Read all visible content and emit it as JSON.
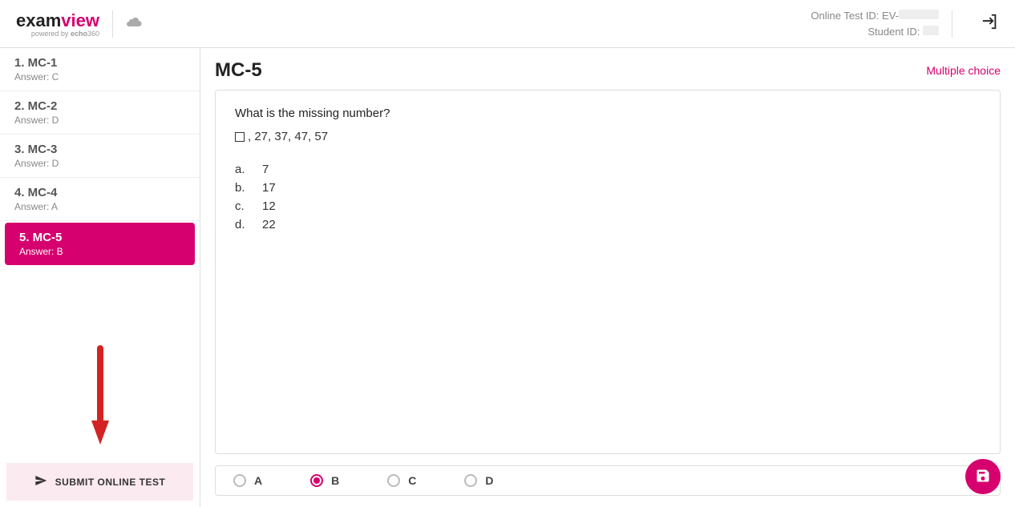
{
  "header": {
    "logo_part1": "exam",
    "logo_part2": "view",
    "logo_sub_prefix": "powered by ",
    "logo_sub_brand": "echo",
    "logo_sub_suffix": "360",
    "test_id_label": "Online Test ID: EV-",
    "student_id_label": "Student ID: "
  },
  "sidebar": {
    "items": [
      {
        "title": "1. MC-1",
        "answer": "Answer: C",
        "active": false
      },
      {
        "title": "2. MC-2",
        "answer": "Answer: D",
        "active": false
      },
      {
        "title": "3. MC-3",
        "answer": "Answer: D",
        "active": false
      },
      {
        "title": "4. MC-4",
        "answer": "Answer: A",
        "active": false
      },
      {
        "title": "5. MC-5",
        "answer": "Answer: B",
        "active": true
      }
    ],
    "submit_label": "SUBMIT ONLINE TEST"
  },
  "question": {
    "title": "MC-5",
    "type_label": "Multiple choice",
    "text": "What is the missing number?",
    "sequence": ", 27, 37, 47, 57",
    "choices": [
      {
        "letter": "a.",
        "text": "7"
      },
      {
        "letter": "b.",
        "text": "17"
      },
      {
        "letter": "c.",
        "text": "12"
      },
      {
        "letter": "d.",
        "text": "22"
      }
    ]
  },
  "answer_bar": {
    "options": [
      {
        "label": "A",
        "selected": false
      },
      {
        "label": "B",
        "selected": true
      },
      {
        "label": "C",
        "selected": false
      },
      {
        "label": "D",
        "selected": false
      }
    ]
  }
}
